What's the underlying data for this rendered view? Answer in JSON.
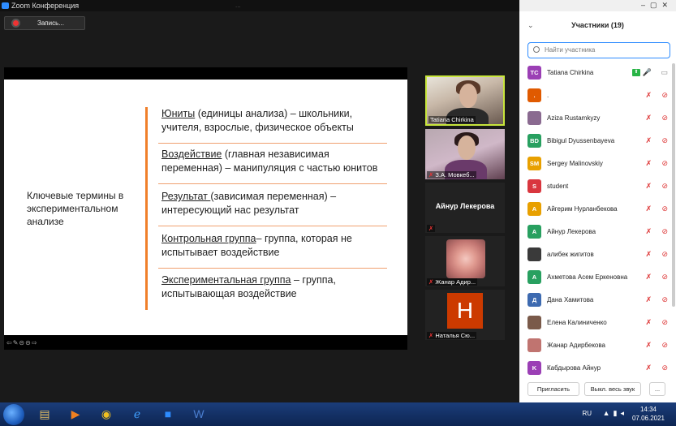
{
  "window": {
    "title": "Zoom Конференция",
    "ghost_title": "..."
  },
  "record": {
    "label": "Запись..."
  },
  "slide": {
    "left_term": "Ключевые термины в экспериментальном анализе",
    "items": [
      {
        "term": "Юниты",
        "rest": " (единицы анализа) – школьники, учителя, взрослые, физическое объекты"
      },
      {
        "term": "Воздействие",
        "rest": " (главная независимая переменная) – манипуляция с частью юнитов"
      },
      {
        "term": "Результат ",
        "rest": "(зависимая переменная) – интересующий нас результат"
      },
      {
        "term": "Контрольная группа",
        "rest": "– группа, которая не испытывает воздействие"
      },
      {
        "term": "Экспериментальная группа",
        "rest": " – группа, испытывающая воздействие"
      }
    ],
    "tools": "⇦✎⊝⊝⇨"
  },
  "videos": [
    {
      "name": "Tatiana Chirkina"
    },
    {
      "name": "З.А. Мовкеб..."
    },
    {
      "name": "",
      "center": "Айнур Лекерова"
    },
    {
      "name": "Жанар Адир..."
    },
    {
      "name": "Наталья Сю...",
      "initial": "H"
    }
  ],
  "panel": {
    "title": "Участники (19)",
    "search_placeholder": "Найти участника",
    "participants": [
      {
        "initials": "TC",
        "name": "Tatiana Chirkina",
        "color": "#9b3fb5",
        "host": true
      },
      {
        "initials": ".",
        "name": ".",
        "color": "#e05a00"
      },
      {
        "initials": "",
        "name": "Aziza Rustamkyzy",
        "color": "#8a6a90"
      },
      {
        "initials": "BD",
        "name": "Bibigul Dyussenbayeva",
        "color": "#28a060"
      },
      {
        "initials": "SM",
        "name": "Sergey Malinovskiy",
        "color": "#e8a000"
      },
      {
        "initials": "S",
        "name": "student",
        "color": "#d9363e"
      },
      {
        "initials": "A",
        "name": "Айгерим Нурланбекова",
        "color": "#e8a000"
      },
      {
        "initials": "A",
        "name": "Айнур Лекерова",
        "color": "#28a060"
      },
      {
        "initials": "",
        "name": "алибек жигитов",
        "color": "#3a3a3a"
      },
      {
        "initials": "A",
        "name": "Ахметова Асем Еркеновна",
        "color": "#28a060"
      },
      {
        "initials": "Д",
        "name": "Дана Хамитова",
        "color": "#3d6ab0"
      },
      {
        "initials": "",
        "name": "Елена Калиниченко",
        "color": "#7a5a4a"
      },
      {
        "initials": "",
        "name": "Жанар Адирбекова",
        "color": "#c07470"
      },
      {
        "initials": "K",
        "name": "Кабдырова Айнур",
        "color": "#9b3fb5"
      }
    ],
    "invite_label": "Пригласить",
    "mute_all_label": "Выкл. весь звук",
    "more_label": "..."
  },
  "taskbar": {
    "lang": "RU",
    "time": "14:34",
    "date": "07.06.2021"
  }
}
